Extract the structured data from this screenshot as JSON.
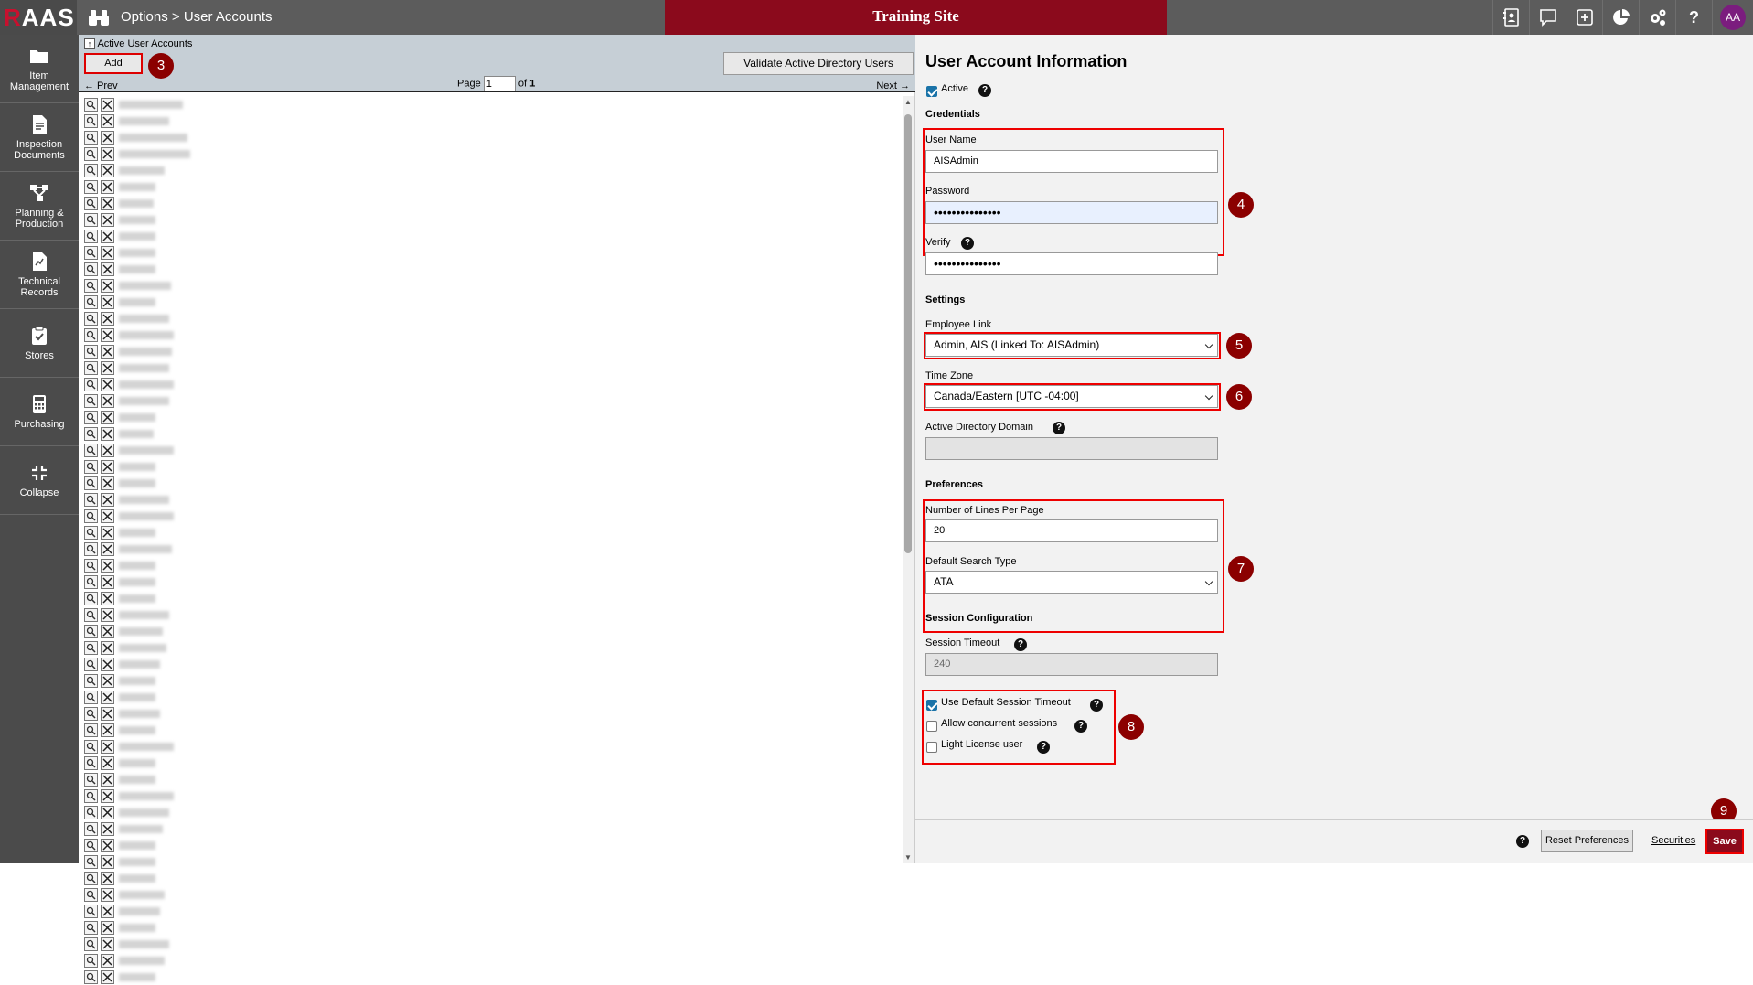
{
  "header": {
    "logo": "RAAS",
    "breadcrumb_parent": "Options",
    "breadcrumb_separator": ">",
    "breadcrumb_current": "User Accounts",
    "site_banner": "Training Site",
    "avatar_initials": "AA",
    "help_glyph": "?"
  },
  "nav": {
    "items": [
      {
        "label_line1": "Item",
        "label_line2": "Management",
        "icon": "folder-icon"
      },
      {
        "label_line1": "Inspection",
        "label_line2": "Documents",
        "icon": "document-icon"
      },
      {
        "label_line1": "Planning &",
        "label_line2": "Production",
        "icon": "flow-icon"
      },
      {
        "label_line1": "Technical",
        "label_line2": "Records",
        "icon": "records-icon"
      },
      {
        "label_line1": "Stores",
        "label_line2": "",
        "icon": "clipboard-check-icon"
      },
      {
        "label_line1": "Purchasing",
        "label_line2": "",
        "icon": "calculator-icon"
      },
      {
        "label_line1": "Collapse",
        "label_line2": "",
        "icon": "collapse-icon"
      }
    ]
  },
  "list": {
    "title": "Active User Accounts",
    "add_label": "Add",
    "validate_label": "Validate Active Directory Users",
    "prev_label": "← Prev",
    "next_label": "Next →",
    "page_label": "Page",
    "page_value": "1",
    "of_label": "of",
    "total_pages": "1"
  },
  "form": {
    "title": "User Account Information",
    "active_label": "Active",
    "credentials_heading": "Credentials",
    "username_label": "User Name",
    "username_value": "AISAdmin",
    "password_label": "Password",
    "password_value": "•••••••••••••••",
    "verify_label": "Verify",
    "verify_value": "•••••••••••••••",
    "settings_heading": "Settings",
    "employee_link_label": "Employee Link",
    "employee_link_value": "Admin, AIS (Linked To: AISAdmin)",
    "timezone_label": "Time Zone",
    "timezone_value": "Canada/Eastern [UTC -04:00]",
    "ad_domain_label": "Active Directory Domain",
    "ad_domain_value": "",
    "preferences_heading": "Preferences",
    "lines_per_page_label": "Number of Lines Per Page",
    "lines_per_page_value": "20",
    "search_type_label": "Default Search Type",
    "search_type_value": "ATA",
    "session_heading": "Session Configuration",
    "session_timeout_label": "Session Timeout",
    "session_timeout_value": "240",
    "use_default_timeout_label": "Use Default Session Timeout",
    "concurrent_label": "Allow concurrent sessions",
    "light_license_label": "Light License user"
  },
  "footer": {
    "reset_label": "Reset Preferences",
    "securities_label": "Securities",
    "save_label": "Save"
  },
  "steps": {
    "s3": "3",
    "s4": "4",
    "s5": "5",
    "s6": "6",
    "s7": "7",
    "s8": "8",
    "s9": "9"
  },
  "colors": {
    "accent": "#8b0a1c",
    "highlight": "#e00000",
    "topbar": "#5c5c5c",
    "nav": "#4b4b4b"
  }
}
